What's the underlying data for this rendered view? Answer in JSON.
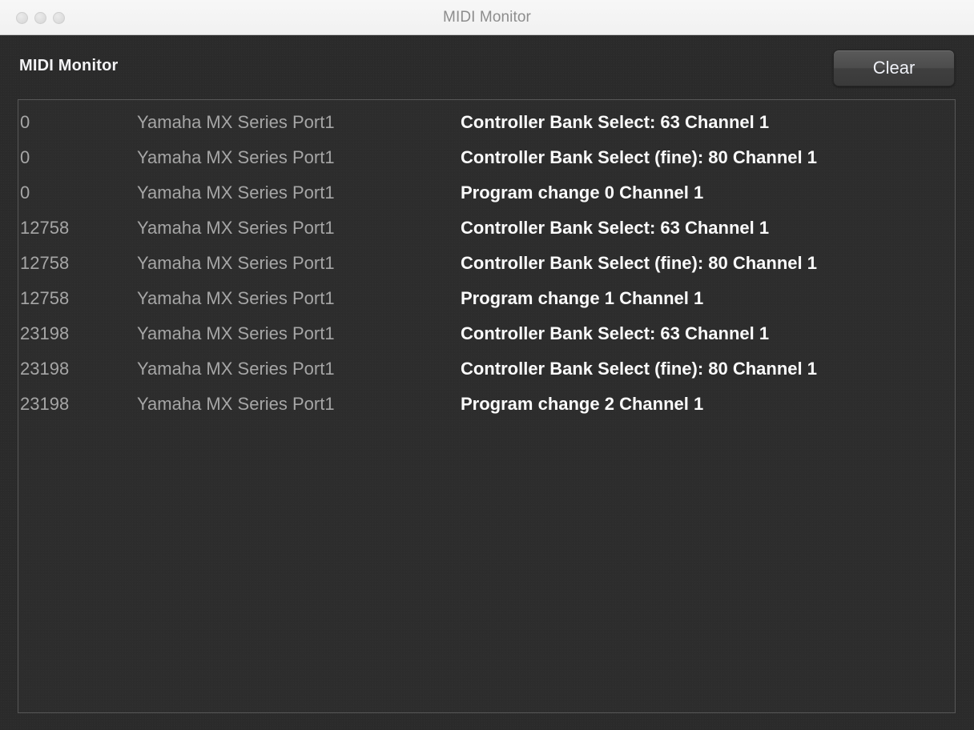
{
  "window": {
    "title": "MIDI Monitor",
    "traffic_lights": [
      {
        "name": "close-button",
        "state": "inactive"
      },
      {
        "name": "minimize-button",
        "state": "inactive"
      },
      {
        "name": "zoom-button",
        "state": "inactive"
      }
    ]
  },
  "header": {
    "title": "MIDI Monitor",
    "clear_label": "Clear"
  },
  "colors": {
    "titlebar_bg": "#f4f4f4",
    "titlebar_text": "#8d8d8d",
    "body_bg": "#2b2b2b",
    "panel_border": "#585858",
    "dim_text": "#a6a6a6",
    "bright_text": "#fbfbfb",
    "button_face": "#4c4c4c"
  },
  "log": {
    "columns": [
      "timestamp",
      "port",
      "message"
    ],
    "rows": [
      {
        "timestamp": "0",
        "port": "Yamaha MX Series Port1",
        "message": "Controller Bank Select: 63 Channel 1"
      },
      {
        "timestamp": "0",
        "port": "Yamaha MX Series Port1",
        "message": "Controller Bank Select (fine): 80 Channel 1"
      },
      {
        "timestamp": "0",
        "port": "Yamaha MX Series Port1",
        "message": "Program change 0 Channel 1"
      },
      {
        "timestamp": "12758",
        "port": "Yamaha MX Series Port1",
        "message": "Controller Bank Select: 63 Channel 1"
      },
      {
        "timestamp": "12758",
        "port": "Yamaha MX Series Port1",
        "message": "Controller Bank Select (fine): 80 Channel 1"
      },
      {
        "timestamp": "12758",
        "port": "Yamaha MX Series Port1",
        "message": "Program change 1 Channel 1"
      },
      {
        "timestamp": "23198",
        "port": "Yamaha MX Series Port1",
        "message": "Controller Bank Select: 63 Channel 1"
      },
      {
        "timestamp": "23198",
        "port": "Yamaha MX Series Port1",
        "message": "Controller Bank Select (fine): 80 Channel 1"
      },
      {
        "timestamp": "23198",
        "port": "Yamaha MX Series Port1",
        "message": "Program change 2 Channel 1"
      }
    ]
  }
}
